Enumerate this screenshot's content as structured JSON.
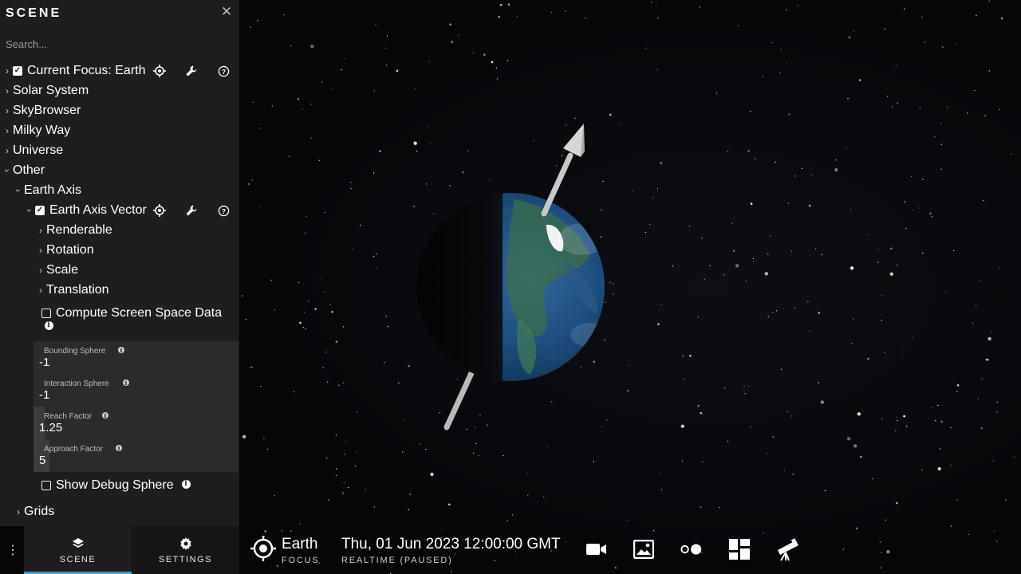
{
  "panel": {
    "title": "SCENE",
    "close_icon": "close-icon",
    "search_placeholder": "Search..."
  },
  "tree": {
    "current_focus": "Current Focus: Earth",
    "solar_system": "Solar System",
    "skybrowser": "SkyBrowser",
    "milky_way": "Milky Way",
    "universe": "Universe",
    "other": "Other",
    "earth_axis": "Earth Axis",
    "earth_axis_vector": "Earth Axis Vector",
    "renderable": "Renderable",
    "rotation": "Rotation",
    "scale": "Scale",
    "translation": "Translation",
    "compute_screen_space": "Compute Screen Space Data",
    "show_debug_sphere": "Show Debug Sphere",
    "grids": "Grids"
  },
  "properties": {
    "bounding_sphere_label": "Bounding Sphere",
    "bounding_sphere_value": "-1",
    "interaction_sphere_label": "Interaction Sphere",
    "interaction_sphere_value": "-1",
    "reach_factor_label": "Reach Factor",
    "reach_factor_value": "1.25",
    "approach_factor_label": "Approach Factor",
    "approach_factor_value": "5"
  },
  "bottom": {
    "scene_tab": "SCENE",
    "settings_tab": "SETTINGS",
    "focus_name": "Earth",
    "focus_label": "FOCUS",
    "time": "Thu, 01 Jun 2023 12:00:00 GMT",
    "time_status": "REALTIME (PAUSED)"
  },
  "colors": {
    "panel_bg": "#1e1e1f",
    "accent": "#3aa0d8",
    "space_bg": "#050608"
  }
}
